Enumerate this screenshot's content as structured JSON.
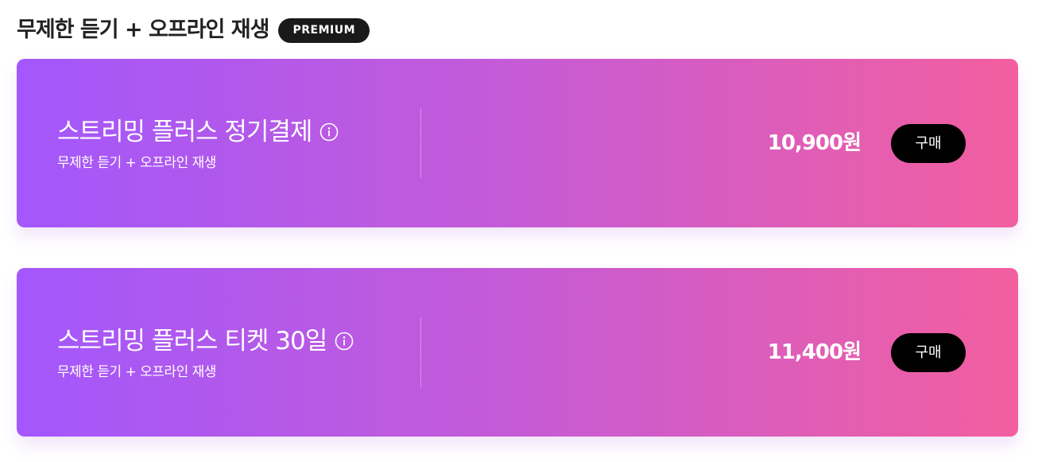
{
  "section": {
    "title": "무제한 듣기 + 오프라인 재생",
    "badge": "PREMIUM"
  },
  "products": [
    {
      "name": "스트리밍 플러스 정기결제",
      "description": "무제한 듣기 + 오프라인 재생",
      "price": "10,900원",
      "buy_label": "구매",
      "info_icon": "info-circle-icon"
    },
    {
      "name": "스트리밍 플러스 티켓 30일",
      "description": "무제한 듣기 + 오프라인 재생",
      "price": "11,400원",
      "buy_label": "구매",
      "info_icon": "info-circle-icon"
    }
  ],
  "colors": {
    "gradient_start": "#a357fc",
    "gradient_mid": "#c55bd6",
    "gradient_end": "#f35f9f",
    "button_bg": "#000000",
    "badge_bg": "#1a1a1a"
  }
}
